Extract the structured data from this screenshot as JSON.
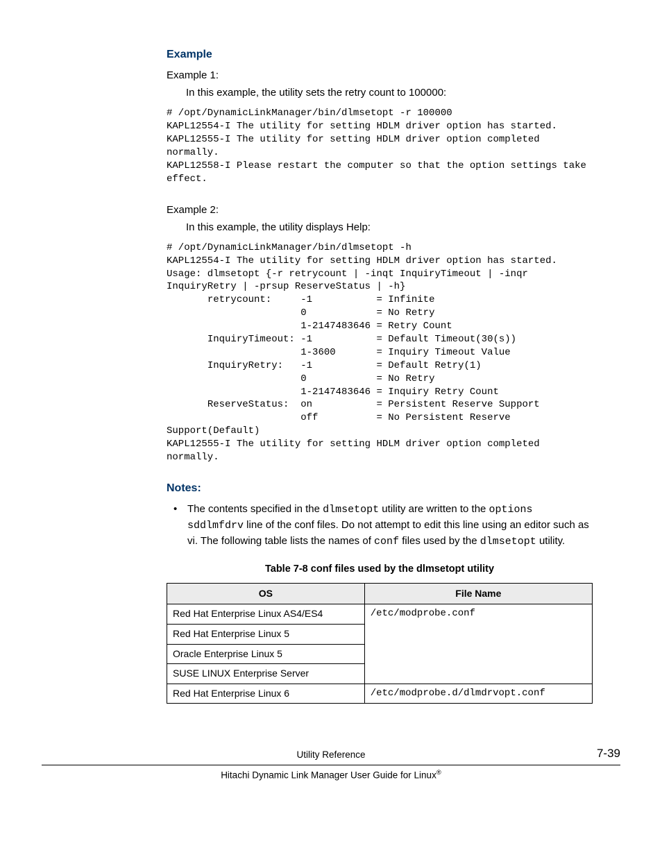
{
  "headings": {
    "example": "Example",
    "notes": "Notes:"
  },
  "example1": {
    "label": "Example 1:",
    "intro": "In this example, the utility sets the retry count to 100000:",
    "code": "# /opt/DynamicLinkManager/bin/dlmsetopt -r 100000\nKAPL12554-I The utility for setting HDLM driver option has started.\nKAPL12555-I The utility for setting HDLM driver option completed normally.\nKAPL12558-I Please restart the computer so that the option settings take effect."
  },
  "example2": {
    "label": "Example 2:",
    "intro": "In this example, the utility displays Help:",
    "code": "# /opt/DynamicLinkManager/bin/dlmsetopt -h\nKAPL12554-I The utility for setting HDLM driver option has started.\nUsage: dlmsetopt {-r retrycount | -inqt InquiryTimeout | -inqr InquiryRetry | -prsup ReserveStatus | -h}\n       retrycount:     -1           = Infinite\n                       0            = No Retry\n                       1-2147483646 = Retry Count\n       InquiryTimeout: -1           = Default Timeout(30(s))\n                       1-3600       = Inquiry Timeout Value\n       InquiryRetry:   -1           = Default Retry(1)\n                       0            = No Retry\n                       1-2147483646 = Inquiry Retry Count\n       ReserveStatus:  on           = Persistent Reserve Support\n                       off          = No Persistent Reserve Support(Default)\nKAPL12555-I The utility for setting HDLM driver option completed normally."
  },
  "notes": {
    "item1": {
      "p1a": "The contents specified in the ",
      "p1b": "dlmsetopt",
      "p1c": " utility are written to the ",
      "p1d": "options sddlmfdrv",
      "p1e": " line of the conf files. Do not attempt to edit this line using an editor such as vi. The following table lists the names of ",
      "p1f": "conf",
      "p1g": " files used by the ",
      "p1h": "dlmsetopt",
      "p1i": " utility."
    }
  },
  "table": {
    "caption": "Table 7-8 conf files used by the dlmsetopt utility",
    "headers": {
      "os": "OS",
      "file": "File Name"
    },
    "rows": {
      "r1os": "Red Hat Enterprise Linux AS4/ES4",
      "r1file": "/etc/modprobe.conf",
      "r2os": "Red Hat Enterprise Linux 5",
      "r3os": "Oracle Enterprise Linux 5",
      "r4os": "SUSE LINUX Enterprise Server",
      "r5os": "Red Hat Enterprise Linux 6",
      "r5file": "/etc/modprobe.d/dlmdrvopt.conf"
    }
  },
  "footer": {
    "center": "Utility Reference",
    "page": "7-39",
    "bottom_a": "Hitachi Dynamic Link Manager User Guide for Linux",
    "bottom_b": "®"
  }
}
